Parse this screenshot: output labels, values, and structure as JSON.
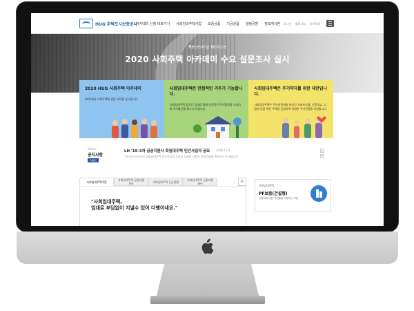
{
  "header": {
    "logo_text": "HUG 주택도시보증공사",
    "nav": [
      "아카데미 신청 바로가기",
      "사회임대주택사업",
      "보증상품",
      "기금상품",
      "알림공방",
      "정보게시판"
    ],
    "util": [
      "로그인",
      "회원가입",
      "사이트맵"
    ]
  },
  "hero": {
    "subtitle": "Recently Notice",
    "title": "2020 사회주택 아카데미 수요 설문조사 실시"
  },
  "panels": [
    {
      "title": "2020 HUG 사회주택 아카데미",
      "desc": "HUG에서 사회주택에 관한 교육을 실시합니다.",
      "color": "#8fc3f0"
    },
    {
      "title": "사회임대주택은 안정적인 거주가 가능합니다.",
      "desc": "사회임대주택 장기간 임대료 통해 안정적인 주거환경을 조성하여 주거불안을 해소시켜 줍니다.",
      "color": "#a7d47c"
    },
    {
      "title": "사회임대주택은 주거약자를 위한 대안입니다.",
      "desc": "사회임대주택은 주거지원계층 대상인 사회초년생, 신혼부부, 고령자 등을 위한 주택을 공급하며 저렴한 주거안정을 지원합니다.",
      "color": "#f4e36a"
    }
  ],
  "notice": {
    "label_en": "Notice",
    "label": "공지사항",
    "more": "더보기",
    "title": "LH '19-3차 공공지원사 회임대주택 민간사업자 공모",
    "date": "2019.12.9",
    "desc": "'19-3차 공공지원 사회임대주택 민간사업자 공모의 자세한 내용은 첨부파일을 확인하시기 바랍니다."
  },
  "tabs": [
    "사회임대주택이란",
    "사회임대주택 금융상품 개요",
    "사회임대주택 공급현황",
    "사회임대주택 금융지원센터"
  ],
  "quote_lines": [
    "\"사회임대주택,",
    "임대료 부담없이 지낼수 있어 다행이네요.\""
  ],
  "side": {
    "category": "사회임대주택",
    "title": "PF보증(건설형)",
    "desc": "사업비에 대한 PF대출을 지원하는 보증"
  },
  "colors": {
    "accent": "#2b5fa5",
    "icon_blue": "#2f7fd1"
  }
}
